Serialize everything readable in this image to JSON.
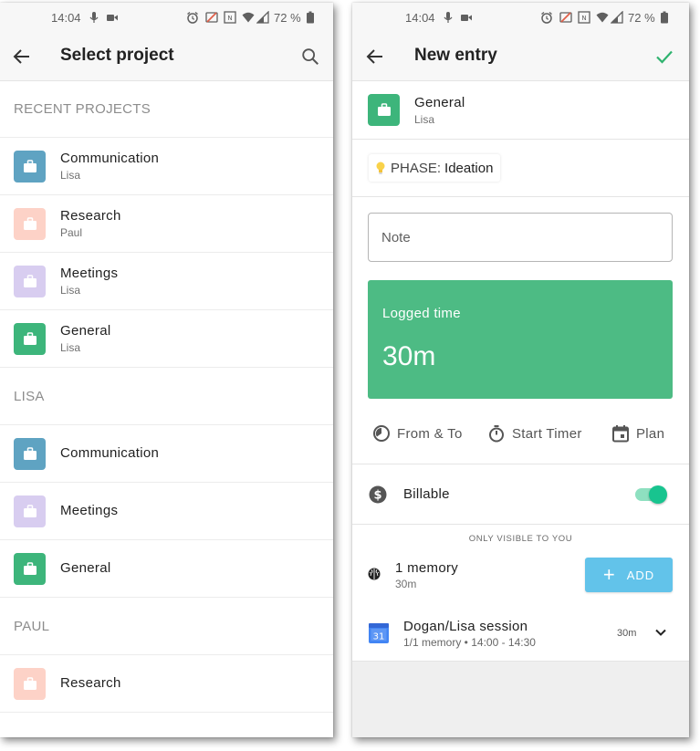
{
  "status_bar": {
    "time": "14:04",
    "battery_pct": "72 %"
  },
  "select_project": {
    "title": "Select project",
    "sections": [
      {
        "header": "RECENT PROJECTS",
        "items": [
          {
            "name": "Communication",
            "owner": "Lisa",
            "color": "#5fa3c2"
          },
          {
            "name": "Research",
            "owner": "Paul",
            "color": "#fdd2c7"
          },
          {
            "name": "Meetings",
            "owner": "Lisa",
            "color": "#d8cdf0"
          },
          {
            "name": "General",
            "owner": "Lisa",
            "color": "#3db57b"
          }
        ]
      },
      {
        "header": "LISA",
        "items": [
          {
            "name": "Communication",
            "color": "#5fa3c2"
          },
          {
            "name": "Meetings",
            "color": "#d8cdf0"
          },
          {
            "name": "General",
            "color": "#3db57b"
          }
        ]
      },
      {
        "header": "PAUL",
        "items": [
          {
            "name": "Research",
            "color": "#fdd2c7"
          }
        ]
      }
    ]
  },
  "new_entry": {
    "title": "New entry",
    "project": {
      "name": "General",
      "owner": "Lisa",
      "color": "#3db57b"
    },
    "phase": {
      "label": "PHASE:",
      "value": "Ideation"
    },
    "note_placeholder": "Note",
    "logged_time": {
      "label": "Logged time",
      "value": "30m"
    },
    "modes": {
      "from_to": "From & To",
      "start_timer": "Start Timer",
      "plan": "Plan"
    },
    "billable": {
      "label": "Billable",
      "on": true
    },
    "visibility_note": "ONLY VISIBLE TO YOU",
    "memory": {
      "title": "1 memory",
      "duration": "30m",
      "add_label": "ADD"
    },
    "session": {
      "title": "Dogan/Lisa session",
      "detail": "1/1 memory • 14:00 - 14:30",
      "duration": "30m",
      "calendar_day": "31"
    }
  },
  "colors": {
    "accent_green": "#4dbb84",
    "toggle_green": "#18c48f",
    "add_button_blue": "#62c3ea",
    "check_green": "#2fb36f"
  },
  "icons": [
    "arrow-left-icon",
    "search-icon",
    "check-icon",
    "briefcase-icon",
    "lightbulb-icon",
    "clock-half-icon",
    "stopwatch-icon",
    "calendar-icon",
    "dollar-icon",
    "brain-icon",
    "google-calendar-icon",
    "chevron-down-icon"
  ]
}
